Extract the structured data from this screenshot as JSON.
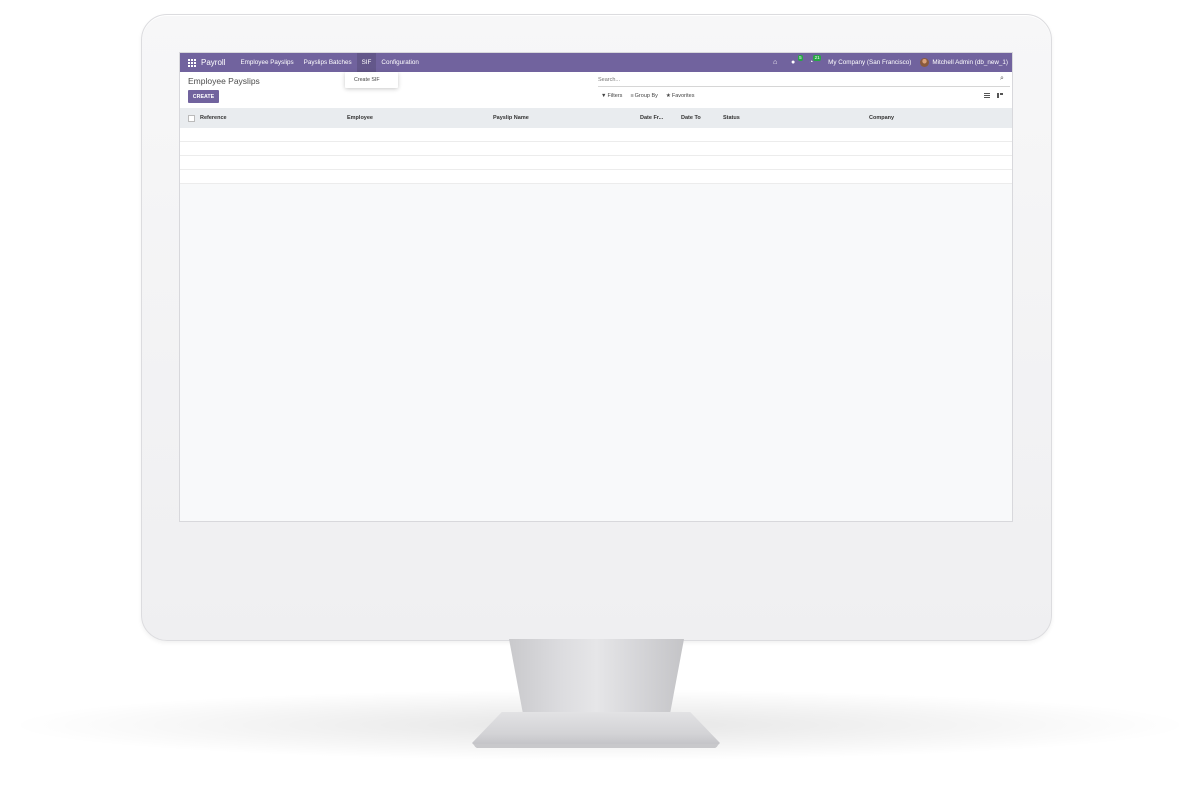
{
  "navbar": {
    "brand": "Payroll",
    "menu": [
      "Employee Payslips",
      "Payslips Batches",
      "SIF",
      "Configuration"
    ],
    "chat_badge": "5",
    "activity_badge": "21",
    "company": "My Company (San Francisco)",
    "user": "Mitchell Admin (db_new_1)"
  },
  "dropdown": {
    "item": "Create SIF"
  },
  "control_panel": {
    "breadcrumb": "Employee Payslips",
    "create_label": "CREATE",
    "search_placeholder": "Search...",
    "filters_label": "Filters",
    "groupby_label": "Group By",
    "favorites_label": "Favorites"
  },
  "table": {
    "columns": [
      "Reference",
      "Employee",
      "Payslip Name",
      "Date Fr...",
      "Date To",
      "Status",
      "Company"
    ]
  },
  "colors": {
    "navbar": "#71639e",
    "badge": "#28a745"
  }
}
